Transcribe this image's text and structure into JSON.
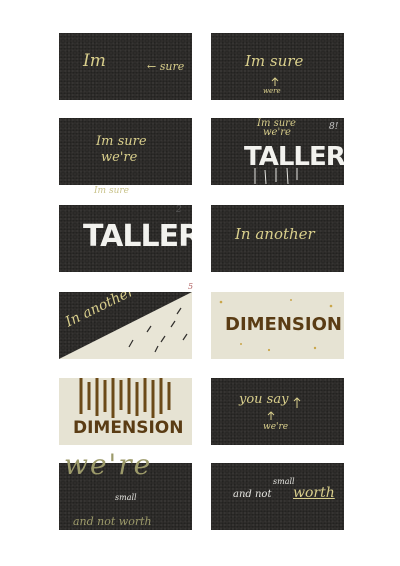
{
  "panels": [
    {
      "id": 1,
      "texts": {
        "a": "Im",
        "b": "← sure"
      }
    },
    {
      "id": 2,
      "texts": {
        "a": "Im sure",
        "b": "were"
      }
    },
    {
      "id": 3,
      "texts": {
        "a": "Im sure",
        "b": "we're"
      }
    },
    {
      "id": 4,
      "texts": {
        "a": "Im sure",
        "b": "we're",
        "c": "TALLER",
        "d": "8!"
      }
    },
    {
      "id": 5,
      "texts": {
        "a": "Im sure",
        "b": "TALLER",
        "c": "2"
      }
    },
    {
      "id": 6,
      "texts": {
        "a": "In another"
      }
    },
    {
      "id": 7,
      "texts": {
        "a": "In another",
        "b": "5"
      }
    },
    {
      "id": 8,
      "texts": {
        "a": "DIMENSION"
      }
    },
    {
      "id": 9,
      "texts": {
        "a": "DIMENSION"
      }
    },
    {
      "id": 10,
      "texts": {
        "a": "you say",
        "b": "we're"
      }
    },
    {
      "id": 11,
      "texts": {
        "a": "we're",
        "b": "small",
        "c": "and not worth"
      }
    },
    {
      "id": 12,
      "texts": {
        "a": "small",
        "b": "and not",
        "c": "worth"
      }
    }
  ],
  "colors": {
    "board": "#2f2d2b",
    "chalk_yellow": "#d9cf8c",
    "chalk_white": "#f2f2ee",
    "wood": "#5a3c14",
    "paper": "#e8e5d6",
    "sage": "#9c9a6a"
  }
}
